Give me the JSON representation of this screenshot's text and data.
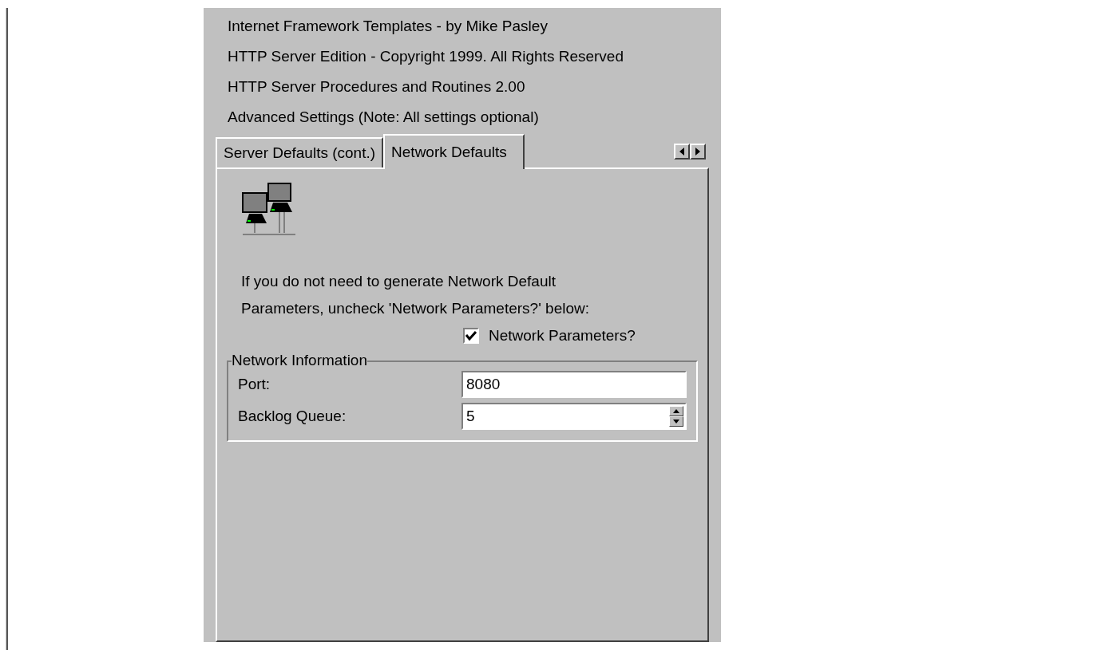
{
  "header_lines": [
    "Internet Framework Templates - by Mike Pasley",
    "HTTP Server Edition - Copyright 1999. All Rights Reserved",
    "HTTP Server Procedures and Routines 2.00",
    "Advanced Settings (Note: All settings optional)"
  ],
  "tabs": [
    {
      "label": "Server Defaults (cont.)",
      "selected": false
    },
    {
      "label": "Network Defaults",
      "selected": true
    }
  ],
  "instructions": [
    "If you do not need to generate Network Default",
    "Parameters, uncheck 'Network Parameters?' below:"
  ],
  "network_parameters": {
    "label": "Network Parameters?",
    "checked": true
  },
  "network_information": {
    "title": "Network Information",
    "fields": [
      {
        "label": "Port:",
        "value": "8080",
        "kind": "text"
      },
      {
        "label": "Backlog Queue:",
        "value": "5",
        "kind": "spinner"
      }
    ]
  }
}
